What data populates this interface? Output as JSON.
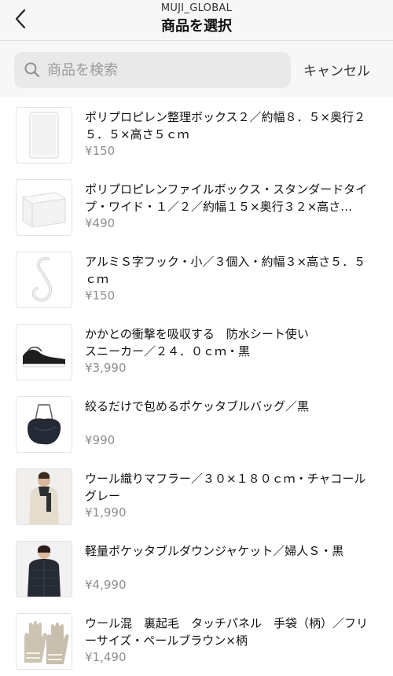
{
  "header": {
    "subtitle": "MUJI_GLOBAL",
    "title": "商品を選択"
  },
  "search": {
    "placeholder": "商品を検索",
    "value": "",
    "cancel_label": "キャンセル"
  },
  "items": [
    {
      "name": "ポリプロピレン整理ボックス２／約幅８．５×奥行２５．５×高さ５ｃｍ",
      "price": "¥150",
      "icon": "storage-box-image"
    },
    {
      "name": "ポリプロピレンファイルボックス・スタンダードタイプ・ワイド・１／２／約幅１５×奥行３２×高さ…",
      "price": "¥490",
      "icon": "file-box-image"
    },
    {
      "name": "アルミＳ字フック・小／３個入・約幅３×高さ５．５ｃｍ",
      "price": "¥150",
      "icon": "s-hook-image"
    },
    {
      "name": "かかとの衝撃を吸収する　防水シート使い\nスニーカー／２４．０ｃｍ・黒",
      "price": "¥3,990",
      "icon": "sneaker-image"
    },
    {
      "name": "絞るだけで包めるポケッタブルバッグ／黒",
      "price": "¥990",
      "icon": "bag-image"
    },
    {
      "name": "ウール織りマフラー／３０×１８０ｃｍ・チャコールグレー",
      "price": "¥1,990",
      "icon": "scarf-model-image"
    },
    {
      "name": "軽量ポケッタブルダウンジャケット／婦人Ｓ・黒",
      "price": "¥4,990",
      "icon": "jacket-model-image"
    },
    {
      "name": "ウール混　裏起毛　タッチパネル　手袋（柄）／フリーサイズ・ペールブラウン×柄",
      "price": "¥1,490",
      "icon": "gloves-image"
    }
  ]
}
